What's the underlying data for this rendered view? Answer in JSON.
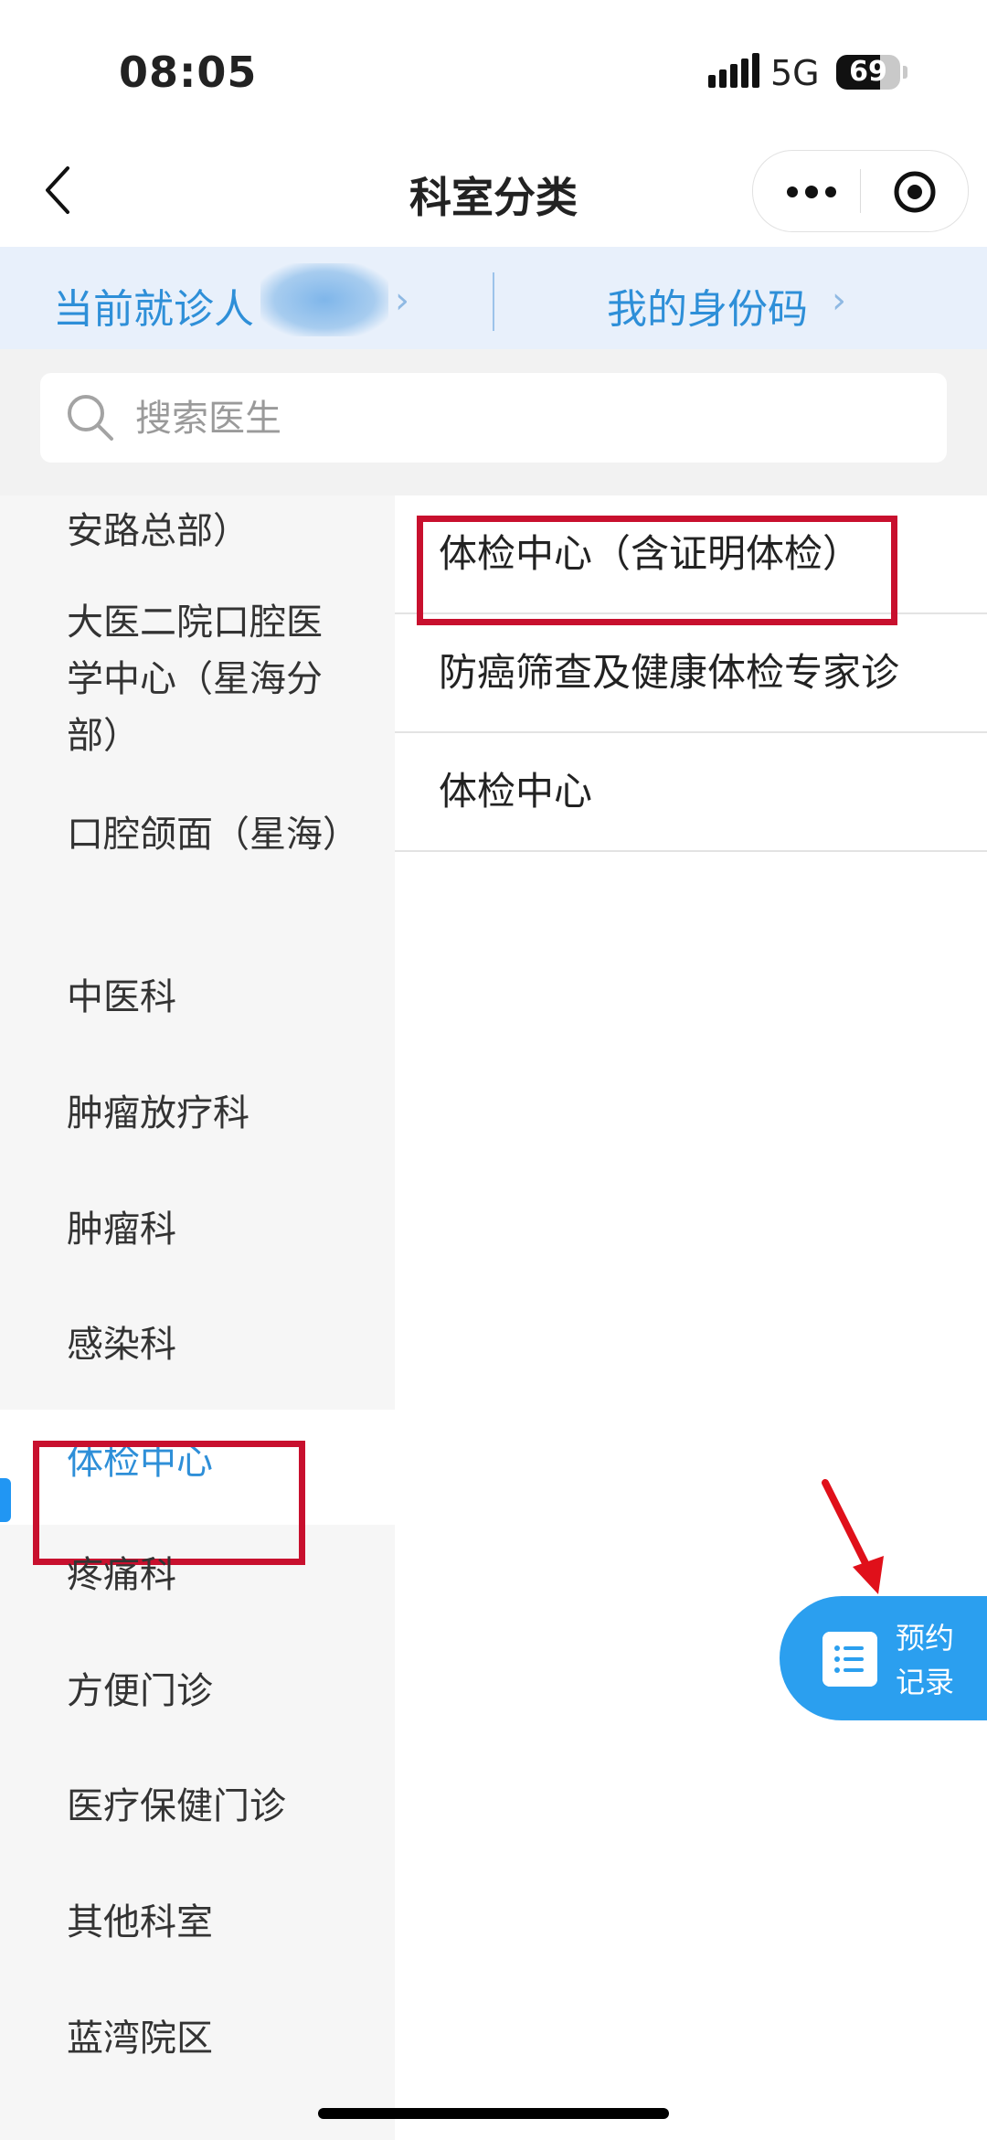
{
  "status_bar": {
    "time": "08:05",
    "network": "5G",
    "battery": "69",
    "battery_level": 0.69
  },
  "nav": {
    "title": "科室分类"
  },
  "patient": {
    "current_label": "当前就诊人",
    "id_code_label": "我的身份码"
  },
  "search": {
    "placeholder": "搜索医生"
  },
  "departments": [
    {
      "label": "安路总部）"
    },
    {
      "label": "大医二院口腔医学中心（星海分部）"
    },
    {
      "label": "口腔颌面（星海）"
    },
    {
      "label": "中医科"
    },
    {
      "label": "肿瘤放疗科"
    },
    {
      "label": "肿瘤科"
    },
    {
      "label": "感染科"
    },
    {
      "label": "体检中心"
    },
    {
      "label": "疼痛科"
    },
    {
      "label": "方便门诊"
    },
    {
      "label": "医疗保健门诊"
    },
    {
      "label": "其他科室"
    },
    {
      "label": "蓝湾院区"
    }
  ],
  "sub_departments": [
    {
      "label": "体检中心（含证明体检）"
    },
    {
      "label": "防癌筛查及健康体检专家诊"
    },
    {
      "label": "体检中心"
    }
  ],
  "floating_button": {
    "label": "预约记录"
  },
  "colors": {
    "accent": "#2e8fd8",
    "highlight": "#c8102e",
    "fab": "#2b9fef"
  }
}
